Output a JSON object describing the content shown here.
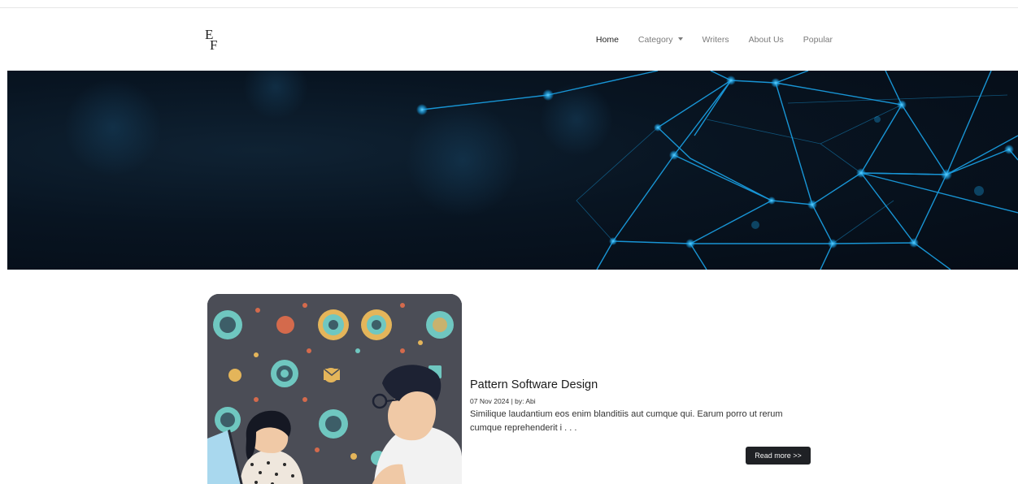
{
  "brand": {
    "logo_text": "EF"
  },
  "nav": {
    "items": [
      {
        "label": "Home",
        "active": true
      },
      {
        "label": "Category",
        "active": false,
        "dropdown": true
      },
      {
        "label": "Writers",
        "active": false
      },
      {
        "label": "About Us",
        "active": false
      },
      {
        "label": "Popular",
        "active": false
      }
    ]
  },
  "hero": {
    "accent_color": "#1aa3e8",
    "background_color": "#071320"
  },
  "article": {
    "title": "Pattern Software Design",
    "meta": "07 Nov 2024 | by: Abi",
    "excerpt": "Similique laudantium eos enim blanditiis aut cumque qui. Earum porro ut rerum cumque reprehenderit i . . .",
    "read_more_label": "Read more >>"
  },
  "colors": {
    "button_bg": "#1f2125",
    "nav_active": "#1f1f1f",
    "nav_inactive": "#7b7b7b"
  }
}
